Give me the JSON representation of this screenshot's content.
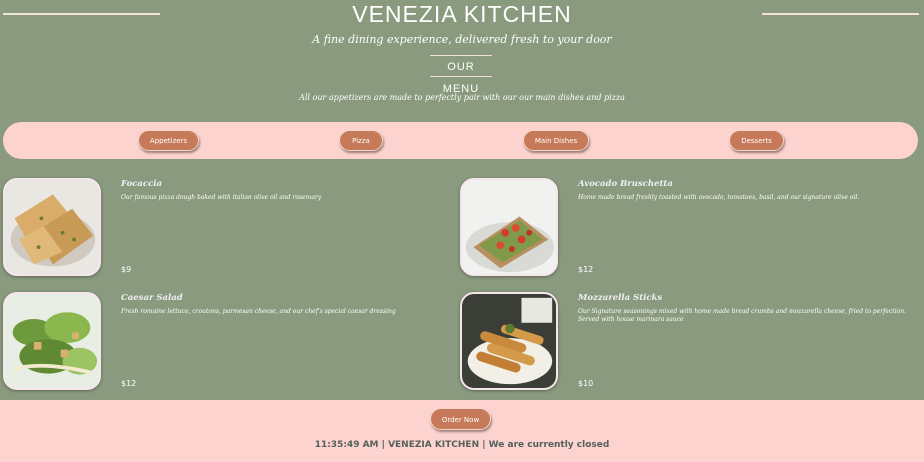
{
  "header": {
    "brand": "VENEZIA KITCHEN",
    "tagline": "A fine dining experience, delivered fresh to your door",
    "menu_heading": "OUR MENU",
    "intro": "All our appetizers are made to perfectly pair with our our main dishes and pizza"
  },
  "tabs": [
    "Appetizers",
    "Pizza",
    "Main Dishes",
    "Desserts"
  ],
  "items": [
    {
      "name": "Focaccia",
      "description": "Our famous pizza dough baked with italian olive oil and rosemary",
      "price": "$9",
      "image_icon": "focaccia-photo"
    },
    {
      "name": "Avocado Bruschetta",
      "description": "Home made bread freshly toasted with avocado, tomatoes, basil, and our signature olive oil.",
      "price": "$12",
      "image_icon": "bruschetta-photo"
    },
    {
      "name": "Caesar Salad",
      "description": "Fresh romaine lettuce, croutons, parmesan cheese, and our chef's special caesar dressing",
      "price": "$12",
      "image_icon": "caesar-salad-photo"
    },
    {
      "name": "Mozzarella Sticks",
      "description": "Our Signature seasonings mixed with home made bread crumbs and mozzarella cheese, fried to perfection. Served with house marinara sauce",
      "price": "$10",
      "image_icon": "mozzarella-sticks-photo"
    }
  ],
  "footer": {
    "order_label": "Order Now",
    "status": "11:35:49 AM | VENEZIA KITCHEN | We are currently closed"
  },
  "colors": {
    "background": "#8a9a7e",
    "accent_pink": "#fdd3d0",
    "button": "#c77a5a",
    "status_text": "#55605a"
  }
}
